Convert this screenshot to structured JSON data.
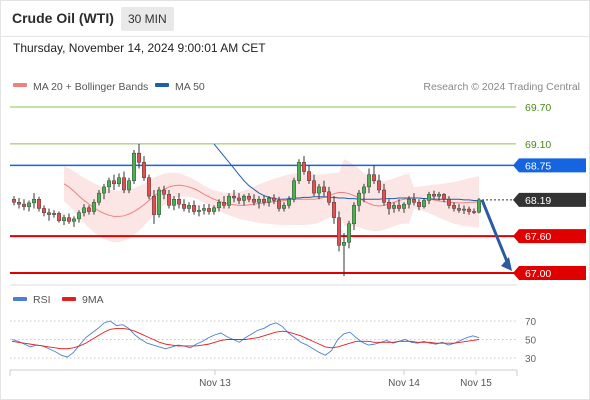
{
  "header": {
    "title": "Crude Oil (WTI)",
    "timeframe": "30 MIN",
    "timestamp": "Thursday, November 14, 2024 9:00:01 AM CET"
  },
  "legend": {
    "ma20": "MA 20 + Bollinger Bands",
    "ma50": "MA 50",
    "credit": "Research © 2024 Trading Central",
    "rsi": "RSI",
    "rsi_ma": "9MA"
  },
  "colors": {
    "ma20": "#f08080",
    "ma50": "#1f5fa8",
    "band_fill": "#fbe0e0",
    "up_candle": "#4caf50",
    "down_candle": "#e05050",
    "wick": "#333333",
    "green_level": "#8bc34a",
    "blue_level": "#1565e0",
    "red_level": "#e00000",
    "current": "#333333",
    "arrow": "#2a5aa0",
    "rsi": "#4a7fd8",
    "rsi_ma": "#e02020"
  },
  "chart_data": {
    "type": "candlestick",
    "title": "Crude Oil (WTI)",
    "timeframe": "30 MIN",
    "ylim": [
      66.9,
      70.0
    ],
    "levels": [
      {
        "value": 69.7,
        "label": "69.70",
        "kind": "green"
      },
      {
        "value": 69.1,
        "label": "69.10",
        "kind": "green"
      },
      {
        "value": 68.75,
        "label": "68.75",
        "kind": "blue"
      },
      {
        "value": 68.19,
        "label": "68.19",
        "kind": "current"
      },
      {
        "value": 67.6,
        "label": "67.60",
        "kind": "red"
      },
      {
        "value": 67.0,
        "label": "67.00",
        "kind": "red"
      }
    ],
    "x_ticks": [
      "Nov 13",
      "Nov 14",
      "Nov 15"
    ],
    "candles": [
      [
        68.2,
        68.25,
        68.1,
        68.15
      ],
      [
        68.15,
        68.22,
        68.05,
        68.12
      ],
      [
        68.12,
        68.2,
        68.02,
        68.08
      ],
      [
        68.08,
        68.18,
        68.0,
        68.14
      ],
      [
        68.14,
        68.3,
        68.05,
        68.2
      ],
      [
        68.2,
        68.24,
        68.0,
        68.05
      ],
      [
        68.05,
        68.1,
        67.92,
        67.98
      ],
      [
        67.98,
        68.05,
        67.85,
        67.95
      ],
      [
        67.95,
        68.02,
        67.9,
        67.97
      ],
      [
        67.97,
        68.0,
        67.82,
        67.85
      ],
      [
        67.85,
        67.95,
        67.78,
        67.9
      ],
      [
        67.9,
        67.97,
        67.8,
        67.84
      ],
      [
        67.84,
        67.92,
        67.75,
        67.88
      ],
      [
        67.88,
        68.02,
        67.82,
        67.98
      ],
      [
        67.98,
        68.12,
        67.92,
        68.06
      ],
      [
        68.06,
        68.1,
        67.95,
        68.0
      ],
      [
        68.0,
        68.2,
        67.95,
        68.15
      ],
      [
        68.15,
        68.35,
        68.1,
        68.3
      ],
      [
        68.3,
        68.45,
        68.2,
        68.4
      ],
      [
        68.4,
        68.55,
        68.3,
        68.5
      ],
      [
        68.5,
        68.6,
        68.35,
        68.45
      ],
      [
        68.45,
        68.62,
        68.4,
        68.55
      ],
      [
        68.55,
        68.65,
        68.3,
        68.35
      ],
      [
        68.35,
        68.55,
        68.3,
        68.5
      ],
      [
        68.5,
        69.0,
        68.45,
        68.95
      ],
      [
        68.95,
        69.1,
        68.7,
        68.8
      ],
      [
        68.8,
        68.9,
        68.5,
        68.55
      ],
      [
        68.55,
        68.6,
        68.2,
        68.25
      ],
      [
        68.25,
        68.35,
        67.8,
        67.95
      ],
      [
        67.95,
        68.4,
        67.9,
        68.35
      ],
      [
        68.35,
        68.42,
        68.2,
        68.28
      ],
      [
        68.28,
        68.35,
        68.05,
        68.1
      ],
      [
        68.1,
        68.25,
        68.02,
        68.2
      ],
      [
        68.2,
        68.3,
        68.05,
        68.12
      ],
      [
        68.12,
        68.2,
        68.0,
        68.05
      ],
      [
        68.05,
        68.15,
        67.98,
        68.1
      ],
      [
        68.1,
        68.18,
        67.95,
        68.0
      ],
      [
        68.0,
        68.1,
        67.92,
        68.02
      ],
      [
        68.02,
        68.12,
        67.95,
        68.05
      ],
      [
        68.05,
        68.12,
        67.95,
        68.0
      ],
      [
        68.0,
        68.1,
        67.95,
        68.06
      ],
      [
        68.06,
        68.2,
        68.0,
        68.15
      ],
      [
        68.15,
        68.25,
        68.05,
        68.1
      ],
      [
        68.1,
        68.3,
        68.05,
        68.25
      ],
      [
        68.25,
        68.35,
        68.15,
        68.22
      ],
      [
        68.22,
        68.3,
        68.12,
        68.18
      ],
      [
        68.18,
        68.28,
        68.1,
        68.25
      ],
      [
        68.25,
        68.3,
        68.15,
        68.2
      ],
      [
        68.2,
        68.28,
        68.1,
        68.15
      ],
      [
        68.15,
        68.25,
        68.05,
        68.2
      ],
      [
        68.2,
        68.26,
        68.1,
        68.15
      ],
      [
        68.15,
        68.25,
        68.08,
        68.22
      ],
      [
        68.22,
        68.28,
        68.12,
        68.18
      ],
      [
        68.18,
        68.24,
        68.0,
        68.05
      ],
      [
        68.05,
        68.15,
        68.0,
        68.1
      ],
      [
        68.1,
        68.25,
        68.05,
        68.2
      ],
      [
        68.2,
        68.55,
        68.15,
        68.5
      ],
      [
        68.5,
        68.85,
        68.45,
        68.8
      ],
      [
        68.8,
        68.9,
        68.6,
        68.65
      ],
      [
        68.65,
        68.75,
        68.45,
        68.5
      ],
      [
        68.5,
        68.6,
        68.25,
        68.3
      ],
      [
        68.3,
        68.45,
        68.2,
        68.4
      ],
      [
        68.4,
        68.5,
        68.25,
        68.32
      ],
      [
        68.32,
        68.4,
        68.1,
        68.15
      ],
      [
        68.15,
        68.25,
        67.8,
        67.9
      ],
      [
        67.9,
        68.0,
        67.35,
        67.45
      ],
      [
        67.45,
        67.65,
        66.95,
        67.5
      ],
      [
        67.5,
        67.85,
        67.4,
        67.8
      ],
      [
        67.8,
        68.15,
        67.7,
        68.1
      ],
      [
        68.1,
        68.35,
        68.0,
        68.3
      ],
      [
        68.3,
        68.45,
        68.15,
        68.4
      ],
      [
        68.4,
        68.7,
        68.3,
        68.6
      ],
      [
        68.6,
        68.75,
        68.45,
        68.5
      ],
      [
        68.5,
        68.6,
        68.3,
        68.35
      ],
      [
        68.35,
        68.45,
        68.1,
        68.15
      ],
      [
        68.15,
        68.2,
        67.95,
        68.05
      ],
      [
        68.05,
        68.15,
        67.98,
        68.1
      ],
      [
        68.1,
        68.2,
        68.0,
        68.05
      ],
      [
        68.05,
        68.15,
        67.98,
        68.12
      ],
      [
        68.12,
        68.25,
        68.05,
        68.2
      ],
      [
        68.2,
        68.3,
        68.1,
        68.15
      ],
      [
        68.15,
        68.2,
        68.02,
        68.08
      ],
      [
        68.08,
        68.22,
        68.05,
        68.18
      ],
      [
        68.18,
        68.32,
        68.12,
        68.28
      ],
      [
        68.28,
        68.34,
        68.2,
        68.25
      ],
      [
        68.25,
        68.32,
        68.18,
        68.28
      ],
      [
        68.28,
        68.3,
        68.15,
        68.2
      ],
      [
        68.2,
        68.25,
        68.05,
        68.1
      ],
      [
        68.1,
        68.15,
        68.0,
        68.05
      ],
      [
        68.05,
        68.12,
        67.98,
        68.02
      ],
      [
        68.02,
        68.1,
        67.96,
        68.04
      ],
      [
        68.04,
        68.08,
        67.95,
        68.0
      ],
      [
        68.0,
        68.05,
        67.96,
        67.99
      ],
      [
        67.99,
        68.22,
        67.97,
        68.19
      ]
    ],
    "ma20": [
      68.45,
      68.4,
      68.33,
      68.25,
      68.18,
      68.12,
      68.06,
      68.01,
      67.97,
      67.94,
      67.92,
      67.92,
      67.93,
      67.96,
      68.0,
      68.05,
      68.11,
      68.18,
      68.25,
      68.31,
      68.36,
      68.4,
      68.42,
      68.43,
      68.42,
      68.4,
      68.37,
      68.33,
      68.28,
      68.24,
      68.2,
      68.17,
      68.14,
      68.12,
      68.11,
      68.1,
      68.1,
      68.11,
      68.12,
      68.13,
      68.14,
      68.15,
      68.16,
      68.17,
      68.18,
      68.19,
      68.2,
      68.2,
      68.2,
      68.2,
      68.2,
      68.21,
      68.23,
      68.26,
      68.29,
      68.31,
      68.31,
      68.29,
      68.26,
      68.22,
      68.17,
      68.13,
      68.1,
      68.09,
      68.1,
      68.12,
      68.15,
      68.18,
      68.2,
      68.21,
      68.22,
      68.22,
      68.21,
      68.2,
      68.19,
      68.17,
      68.16,
      68.15,
      68.14,
      68.14,
      68.14,
      68.15,
      68.15,
      68.16
    ],
    "ma50": [
      69.1,
      69.0,
      68.9,
      68.8,
      68.7,
      68.6,
      68.5,
      68.42,
      68.36,
      68.3,
      68.26,
      68.23,
      68.21,
      68.2,
      68.2,
      68.21,
      68.22,
      68.22,
      68.23,
      68.23,
      68.24,
      68.24,
      68.24,
      68.23,
      68.23,
      68.22,
      68.22,
      68.21,
      68.21,
      68.2,
      68.2,
      68.2,
      68.2,
      68.2,
      68.21,
      68.21,
      68.21,
      68.22,
      68.22,
      68.22,
      68.22,
      68.22,
      68.21,
      68.21,
      68.2,
      68.2,
      68.2,
      68.2,
      68.2,
      68.2,
      68.19,
      68.19,
      68.18,
      68.18
    ],
    "rsi": {
      "label": "RSI",
      "ma_label": "9MA",
      "ticks": [
        70,
        50,
        30
      ],
      "ylim": [
        20,
        80
      ],
      "rsi": [
        50,
        48,
        45,
        42,
        44,
        43,
        40,
        37,
        33,
        31,
        36,
        44,
        52,
        57,
        62,
        68,
        70,
        65,
        66,
        62,
        55,
        50,
        46,
        44,
        42,
        40,
        42,
        44,
        43,
        41,
        45,
        48,
        52,
        55,
        57,
        53,
        50,
        47,
        52,
        56,
        60,
        62,
        66,
        68,
        64,
        57,
        52,
        47,
        44,
        40,
        36,
        33,
        38,
        50,
        56,
        58,
        52,
        47,
        44,
        45,
        47,
        49,
        46,
        48,
        50,
        47,
        46,
        48,
        46,
        45,
        47,
        44,
        46,
        49,
        52,
        54,
        52
      ],
      "rsi_ma": [
        48,
        47,
        46,
        45,
        44,
        43,
        42,
        41,
        40,
        40,
        41,
        43,
        46,
        50,
        54,
        58,
        61,
        62,
        62,
        61,
        59,
        56,
        53,
        50,
        47,
        45,
        44,
        43,
        43,
        43,
        43,
        44,
        45,
        47,
        49,
        50,
        50,
        50,
        50,
        51,
        52,
        54,
        56,
        58,
        59,
        58,
        56,
        54,
        51,
        48,
        45,
        42,
        41,
        42,
        44,
        46,
        48,
        48,
        48,
        47,
        47,
        47,
        47,
        48,
        48,
        48,
        47,
        47,
        47,
        46,
        46,
        46,
        46,
        47,
        48,
        49,
        50
      ]
    }
  }
}
